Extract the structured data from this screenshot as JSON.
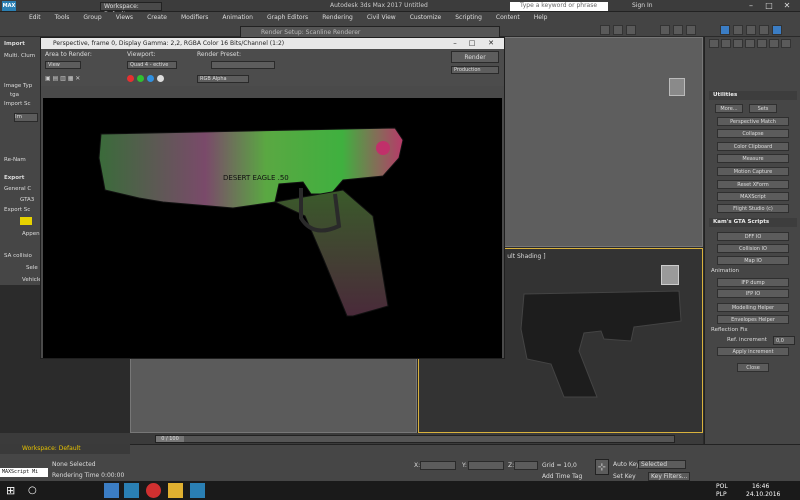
{
  "titlebar": {
    "workspace": "Workspace: Default",
    "app_title": "Autodesk 3ds Max 2017    Untitled",
    "search_placeholder": "Type a keyword or phrase",
    "sign_in": "Sign In"
  },
  "menu": [
    "Edit",
    "Tools",
    "Group",
    "Views",
    "Create",
    "Modifiers",
    "Animation",
    "Graph Editors",
    "Rendering",
    "Civil View",
    "Customize",
    "Scripting",
    "Content",
    "Help"
  ],
  "setup_window": {
    "title": "Render Setup: Scanline Renderer"
  },
  "render_window": {
    "title": "Perspective, frame 0, Display Gamma: 2,2, RGBA Color 16 Bits/Channel (1:2)",
    "area_label": "Area to Render:",
    "area_value": "View",
    "viewport_label": "Viewport:",
    "viewport_value": "Quad 4 - ective",
    "preset_label": "Render Preset:",
    "preset_value": "",
    "render_button": "Render",
    "production_value": "Production",
    "channel_value": "RGB Alpha",
    "gun_text": "DESERT EAGLE .50"
  },
  "left_panel": {
    "labels": [
      "Import",
      "Multi. Clum",
      "Image Typ",
      "tga",
      "Import Sc",
      "Im",
      "Re-Nam",
      "Export",
      "General C",
      "GTA3",
      "Export Sc",
      "Appen",
      "SA collisio",
      "Sele",
      "Vehicle"
    ]
  },
  "viewport": {
    "shading_label": "[ ult Shading ]"
  },
  "cmd_panel": {
    "utilities_header": "Utilities",
    "more_label": "More...",
    "sets_label": "Sets",
    "utilities": [
      "Perspective Match",
      "Collapse",
      "Color Clipboard",
      "Measure",
      "Motion Capture",
      "Reset XForm",
      "MAXScript",
      "Flight Studio (c)"
    ],
    "kam_header": "Kam's GTA Scripts",
    "kam_buttons": [
      "DFF IO",
      "Collision IO",
      "Map IO"
    ],
    "animation_label": "Animation",
    "anim_buttons": [
      "IFP dump",
      "IFP IO"
    ],
    "model_buttons": [
      "Modelling Helper",
      "Envelopes Helper"
    ],
    "reflection_label": "Reflection Fix",
    "ref_increment_label": "Ref. increment",
    "ref_increment_value": "0,0",
    "apply_button": "Apply increment",
    "close_button": "Close"
  },
  "timeline": {
    "frame": "0 / 100"
  },
  "status": {
    "workspace": "Workspace: Default",
    "maxscript": "MAXScript Mi",
    "selection": "None Selected",
    "render_time": "Rendering Time  0:00:00",
    "x_label": "X:",
    "y_label": "Y:",
    "z_label": "Z:",
    "grid": "Grid = 10,0",
    "add_time_tag": "Add Time Tag",
    "auto_key": "Auto Key",
    "set_key": "Set Key",
    "selected": "Selected",
    "key_filters": "Key Filters..."
  },
  "taskbar": {
    "lang": "POL",
    "layout": "PLP",
    "time": "16:46",
    "date": "24.10.2016"
  },
  "colors": {
    "accent": "#2a7fb3",
    "viewport_border_active": "#d9b23d",
    "gun_green": "#3aa83a",
    "gun_pink": "#c0306a"
  }
}
